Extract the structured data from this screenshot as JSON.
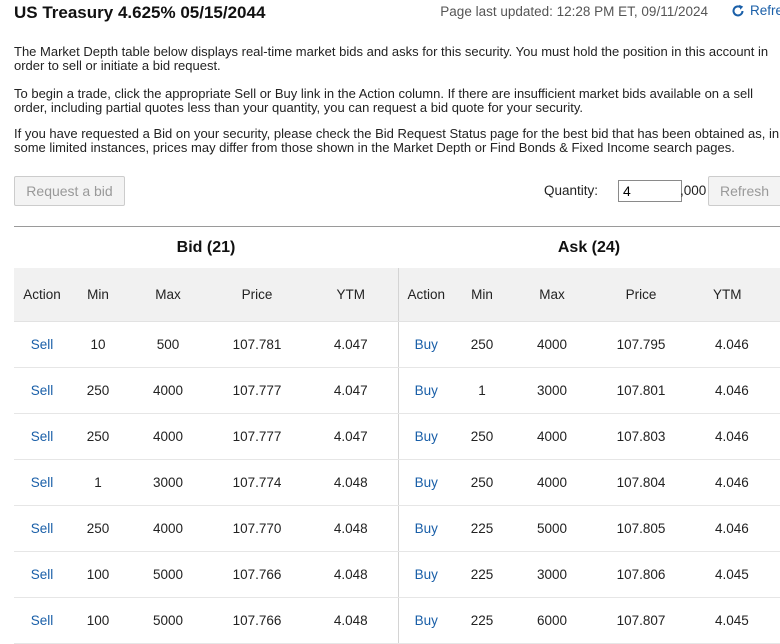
{
  "header": {
    "title": "US Treasury 4.625% 05/15/2044",
    "last_updated": "Page last updated: 12:28 PM ET, 09/11/2024",
    "refresh_label": "Refresh",
    "refresh_icon": "refresh-icon"
  },
  "info": {
    "p1": "The Market Depth table below displays real-time market bids and asks for this security. You must hold the position in this account in order to sell or initiate a bid request.",
    "p2": "To begin a trade, click the appropriate Sell or Buy link in the Action column. If there are insufficient market bids available on a sell order, including partial quotes less than your quantity, you can request a bid quote for your security.",
    "p3": "If you have requested a Bid on your security, please check the Bid Request Status page for the best bid that has been obtained as, in some limited instances, prices may differ from those shown in the Market Depth or Find Bonds & Fixed Income search pages."
  },
  "controls": {
    "request_bid_label": "Request a bid",
    "quantity_label": "Quantity:",
    "quantity_value": "4",
    "quantity_suffix": ",000",
    "refresh_button_label": "Refresh"
  },
  "bid": {
    "title": "Bid (21)",
    "columns": [
      "Action",
      "Min",
      "Max",
      "Price",
      "YTM"
    ],
    "rows": [
      {
        "action": "Sell",
        "min": "10",
        "max": "500",
        "price": "107.781",
        "ytm": "4.047"
      },
      {
        "action": "Sell",
        "min": "250",
        "max": "4000",
        "price": "107.777",
        "ytm": "4.047"
      },
      {
        "action": "Sell",
        "min": "250",
        "max": "4000",
        "price": "107.777",
        "ytm": "4.047"
      },
      {
        "action": "Sell",
        "min": "1",
        "max": "3000",
        "price": "107.774",
        "ytm": "4.048"
      },
      {
        "action": "Sell",
        "min": "250",
        "max": "4000",
        "price": "107.770",
        "ytm": "4.048"
      },
      {
        "action": "Sell",
        "min": "100",
        "max": "5000",
        "price": "107.766",
        "ytm": "4.048"
      },
      {
        "action": "Sell",
        "min": "100",
        "max": "5000",
        "price": "107.766",
        "ytm": "4.048"
      }
    ]
  },
  "ask": {
    "title": "Ask (24)",
    "columns": [
      "Action",
      "Min",
      "Max",
      "Price",
      "YTM"
    ],
    "rows": [
      {
        "action": "Buy",
        "min": "250",
        "max": "4000",
        "price": "107.795",
        "ytm": "4.046"
      },
      {
        "action": "Buy",
        "min": "1",
        "max": "3000",
        "price": "107.801",
        "ytm": "4.046"
      },
      {
        "action": "Buy",
        "min": "250",
        "max": "4000",
        "price": "107.803",
        "ytm": "4.046"
      },
      {
        "action": "Buy",
        "min": "250",
        "max": "4000",
        "price": "107.804",
        "ytm": "4.046"
      },
      {
        "action": "Buy",
        "min": "225",
        "max": "5000",
        "price": "107.805",
        "ytm": "4.046"
      },
      {
        "action": "Buy",
        "min": "225",
        "max": "3000",
        "price": "107.806",
        "ytm": "4.045"
      },
      {
        "action": "Buy",
        "min": "225",
        "max": "6000",
        "price": "107.807",
        "ytm": "4.045"
      }
    ]
  },
  "colors": {
    "link": "#1a5fa8",
    "header_bg": "#f1f1f1",
    "disabled_text": "#999999"
  }
}
